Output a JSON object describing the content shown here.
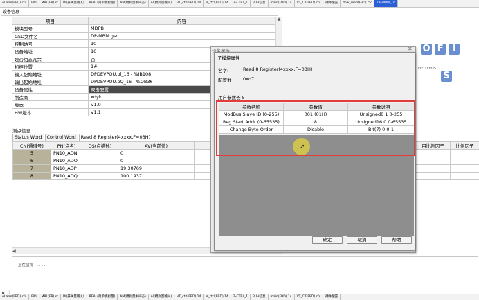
{
  "top_tabs": [
    "ALarm(FBD).cfc",
    "PID",
    "MBL(FB).st",
    "DI(开关量输入)",
    "REAL(简单模拟量)",
    "AM(模拟量中间态)",
    "AI(模拟量输入)",
    "VT_ctrl(FBD).14",
    "V_ctrl(FBD).14",
    "Z-CTRL_1",
    "PUH信息",
    "main(FBD).14",
    "VT_CT(FBD).cfc",
    "硬件配置",
    "flow_read(FBD).cfc",
    "DP-MBM_16"
  ],
  "section_title": "设备信息",
  "prop_table": {
    "headers": [
      "项目",
      "内容"
    ],
    "rows": [
      [
        "模块型号",
        "MDPB"
      ],
      [
        "GSD文件名",
        "DP-MBM.gsd"
      ],
      [
        "控制站号",
        "10"
      ],
      [
        "设备地址",
        "16"
      ],
      [
        "是否组态冗余",
        "否"
      ],
      [
        "机柜位置",
        "1#"
      ],
      [
        "输入起始地址",
        "DPDEVPOU.pl_16 - %IB108"
      ],
      [
        "输出起始地址",
        "DPDEVPOU.pQ_16 - %QB36"
      ],
      [
        "设备属性",
        "双击配置"
      ],
      [
        "制造商",
        "xdyk"
      ],
      [
        "版本",
        "V1.0"
      ],
      [
        "HW版本",
        "V1.1"
      ]
    ]
  },
  "measure_label": "测点信息 :",
  "inner_tabs": [
    "Status Word",
    "Control Word",
    "Read 8 Register(4xxxx,F=03H)"
  ],
  "chan_table": {
    "headers": [
      "CN(通道号)",
      "PN(点名)",
      "DS(点描述)",
      "AV(当前值)",
      "DV(当前"
    ],
    "rows": [
      [
        "5",
        "PN10_ADN",
        "",
        "0",
        ""
      ],
      [
        "6",
        "PN10_ADO",
        "",
        "0",
        ""
      ],
      [
        "7",
        "PN10_ADP",
        "",
        "19.30769",
        ""
      ],
      [
        "8",
        "PN10_ADQ",
        "",
        "100.1937",
        ""
      ]
    ]
  },
  "right_cols": [
    "用比例因子",
    "比例因子"
  ],
  "status_text": "正在监视 . . . . .",
  "logo": {
    "letters": [
      "O",
      "F",
      "I",
      "S"
    ],
    "sub": "FIELD BUS"
  },
  "back_dialog": {
    "title": "设备属性"
  },
  "dialog": {
    "title": "子模块属性",
    "name_label": "名字:",
    "name_value": "Read 8 Register(4xxxx,F=03H)",
    "cfg_label": "配置数",
    "cfg_value": "0xd7",
    "param_len": "用户参数长  5",
    "param_table": {
      "headers": [
        "参数名称",
        "参数值",
        "参数说明"
      ],
      "rows": [
        [
          "ModBus Slave ID (0-255)",
          "001 (01H)",
          "Unsigned8 1 0-255"
        ],
        [
          "Reg Start Addr (0-65535)",
          "8",
          "Unsigned16 0 0-65535"
        ],
        [
          "Change Byte Order",
          "Disable",
          "Bit(7) 0 0-1"
        ]
      ]
    },
    "ok": "确定",
    "cancel": "取消",
    "help": "帮助"
  },
  "bottom_tabs": [
    "ALarm(FBD).cfc",
    "PID",
    "MBL(FB).st",
    "DI(开关量输入)",
    "REAL(简单模拟量)",
    "AM(模拟量中间态)",
    "AI(模拟量输入)",
    "VT_ctrl(FBD).14",
    "V_ctrl(FBD).14",
    "Z-CTRL_1",
    "PUH信息",
    "main(FBD).14",
    "VT_CT(FBD).cfc",
    "硬件配置"
  ],
  "colors": {
    "accent": "#2a5fd8",
    "highlight_box": "#e33c3c",
    "channel_cell": "#b8b29b",
    "logo": "#6a8fd0"
  }
}
